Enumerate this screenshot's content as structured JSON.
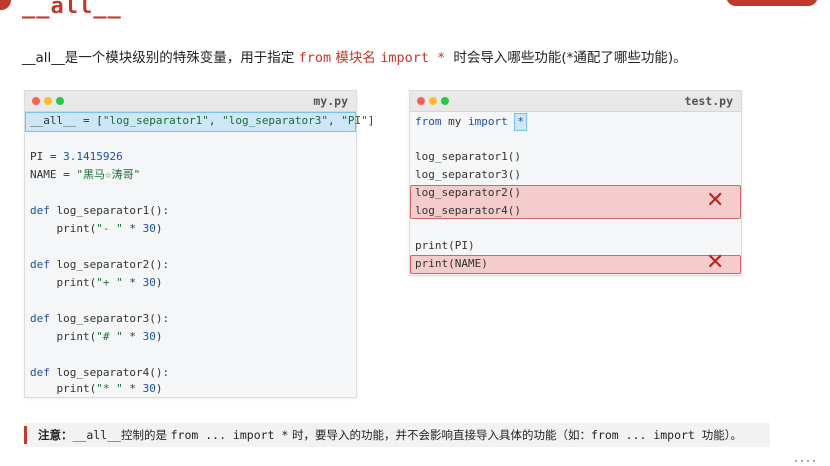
{
  "title": "__all__",
  "intro": {
    "part1": "__all__是一个模块级别的特殊变量，用于指定 ",
    "from_kw": "from",
    "module": " 模块名 ",
    "import_kw": "import",
    "star": " * ",
    "part2": "时会导入哪些功能(*通配了哪些功能)。"
  },
  "my_py": {
    "filename": "my.py",
    "lines": {
      "all_name": "__all__",
      "all_eq": " = [",
      "all_s1": "\"log_separator1\"",
      "all_c1": ", ",
      "all_s2": "\"log_separator3\"",
      "all_c2": ", ",
      "all_s3": "\"PI\"",
      "all_end": "]",
      "pi_name": "PI = ",
      "pi_val": "3.1415926",
      "name_name": "NAME = ",
      "name_val": "\"黑马☆涛哥\"",
      "def": "def",
      "f1": " log_separator1():",
      "p1a": "    print(",
      "p1s": "\"- \"",
      "p1b": " * ",
      "p1n": "30",
      "p1e": ")",
      "f2": " log_separator2():",
      "p2s": "\"+ \"",
      "f3": " log_separator3():",
      "p3s": "\"# \"",
      "f4": " log_separator4():",
      "p4s": "\"* \""
    }
  },
  "test_py": {
    "filename": "test.py",
    "from_kw": "from",
    "module": " my ",
    "import_kw": "import",
    "star": "*",
    "call1": "log_separator1()",
    "call3": "log_separator3()",
    "call2": "log_separator2()",
    "call4": "log_separator4()",
    "print_pi": "print(PI)",
    "print_name": "print(NAME)",
    "x_mark": "✕"
  },
  "note": {
    "label": "注意：",
    "t1": "__all__",
    "t2": "控制的是 ",
    "t3": "from ... import *",
    "t4": " 时，要导入的功能，并不会影响直接导入具体的功能（如：",
    "t5": "from ... import 功能",
    "t6": "）。"
  },
  "colors": {
    "accent": "#c0392b",
    "keyword": "#1f4fa8",
    "string": "#1c6b35",
    "highlight_blue": "#cde7f7",
    "highlight_red": "#f4cccc"
  }
}
